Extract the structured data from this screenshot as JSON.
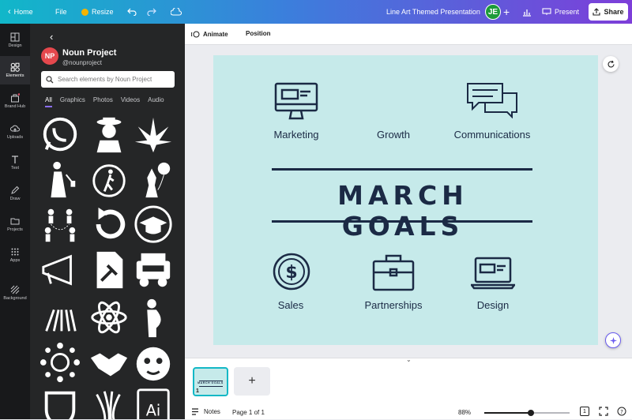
{
  "topbar": {
    "home": "Home",
    "file": "File",
    "resize": "Resize",
    "title": "Line Art Themed Presentation",
    "avatar": "JE",
    "present": "Present",
    "share": "Share"
  },
  "rail": [
    {
      "label": "Design"
    },
    {
      "label": "Elements"
    },
    {
      "label": "Brand Hub"
    },
    {
      "label": "Uploads"
    },
    {
      "label": "Text"
    },
    {
      "label": "Draw"
    },
    {
      "label": "Projects"
    },
    {
      "label": "Apps"
    },
    {
      "label": "Background"
    }
  ],
  "panel": {
    "logo": "NP",
    "name": "Noun Project",
    "handle": "@nounproject",
    "search_placeholder": "Search elements by Noun Project",
    "tabs": [
      "All",
      "Graphics",
      "Photos",
      "Videos",
      "Audio"
    ],
    "tiles": [
      "whatsapp-logo",
      "cowboy-figure",
      "cannabis-leaf",
      "woman-figure",
      "walking-person",
      "chess-piece-balloon",
      "people-network",
      "undo-arrow",
      "graduation-cap",
      "megaphone",
      "legal-document",
      "jeep-vehicle",
      "road-lines",
      "atom",
      "pregnant-woman",
      "coin-network",
      "handshake",
      "tiger-face",
      "shield-badge",
      "striped-shape",
      "ai-file"
    ]
  },
  "toolbar": {
    "animate": "Animate",
    "position": "Position"
  },
  "slide": {
    "labels": {
      "marketing": "Marketing",
      "growth": "Growth",
      "communications": "Communications",
      "sales": "Sales",
      "partnerships": "Partnerships",
      "design": "Design"
    },
    "headline": "MARCH GOALS",
    "colors": {
      "background": "#c6eaea",
      "ink": "#1b2a45"
    }
  },
  "bottom": {
    "thumb_number": "1",
    "notes": "Notes",
    "page": "Page 1 of 1",
    "zoom": "88%",
    "zoom_fraction": 0.55,
    "page_count": "1"
  },
  "colors": {
    "accent": "#8b6ef7",
    "rail": "#18191b",
    "panel": "#252627"
  }
}
